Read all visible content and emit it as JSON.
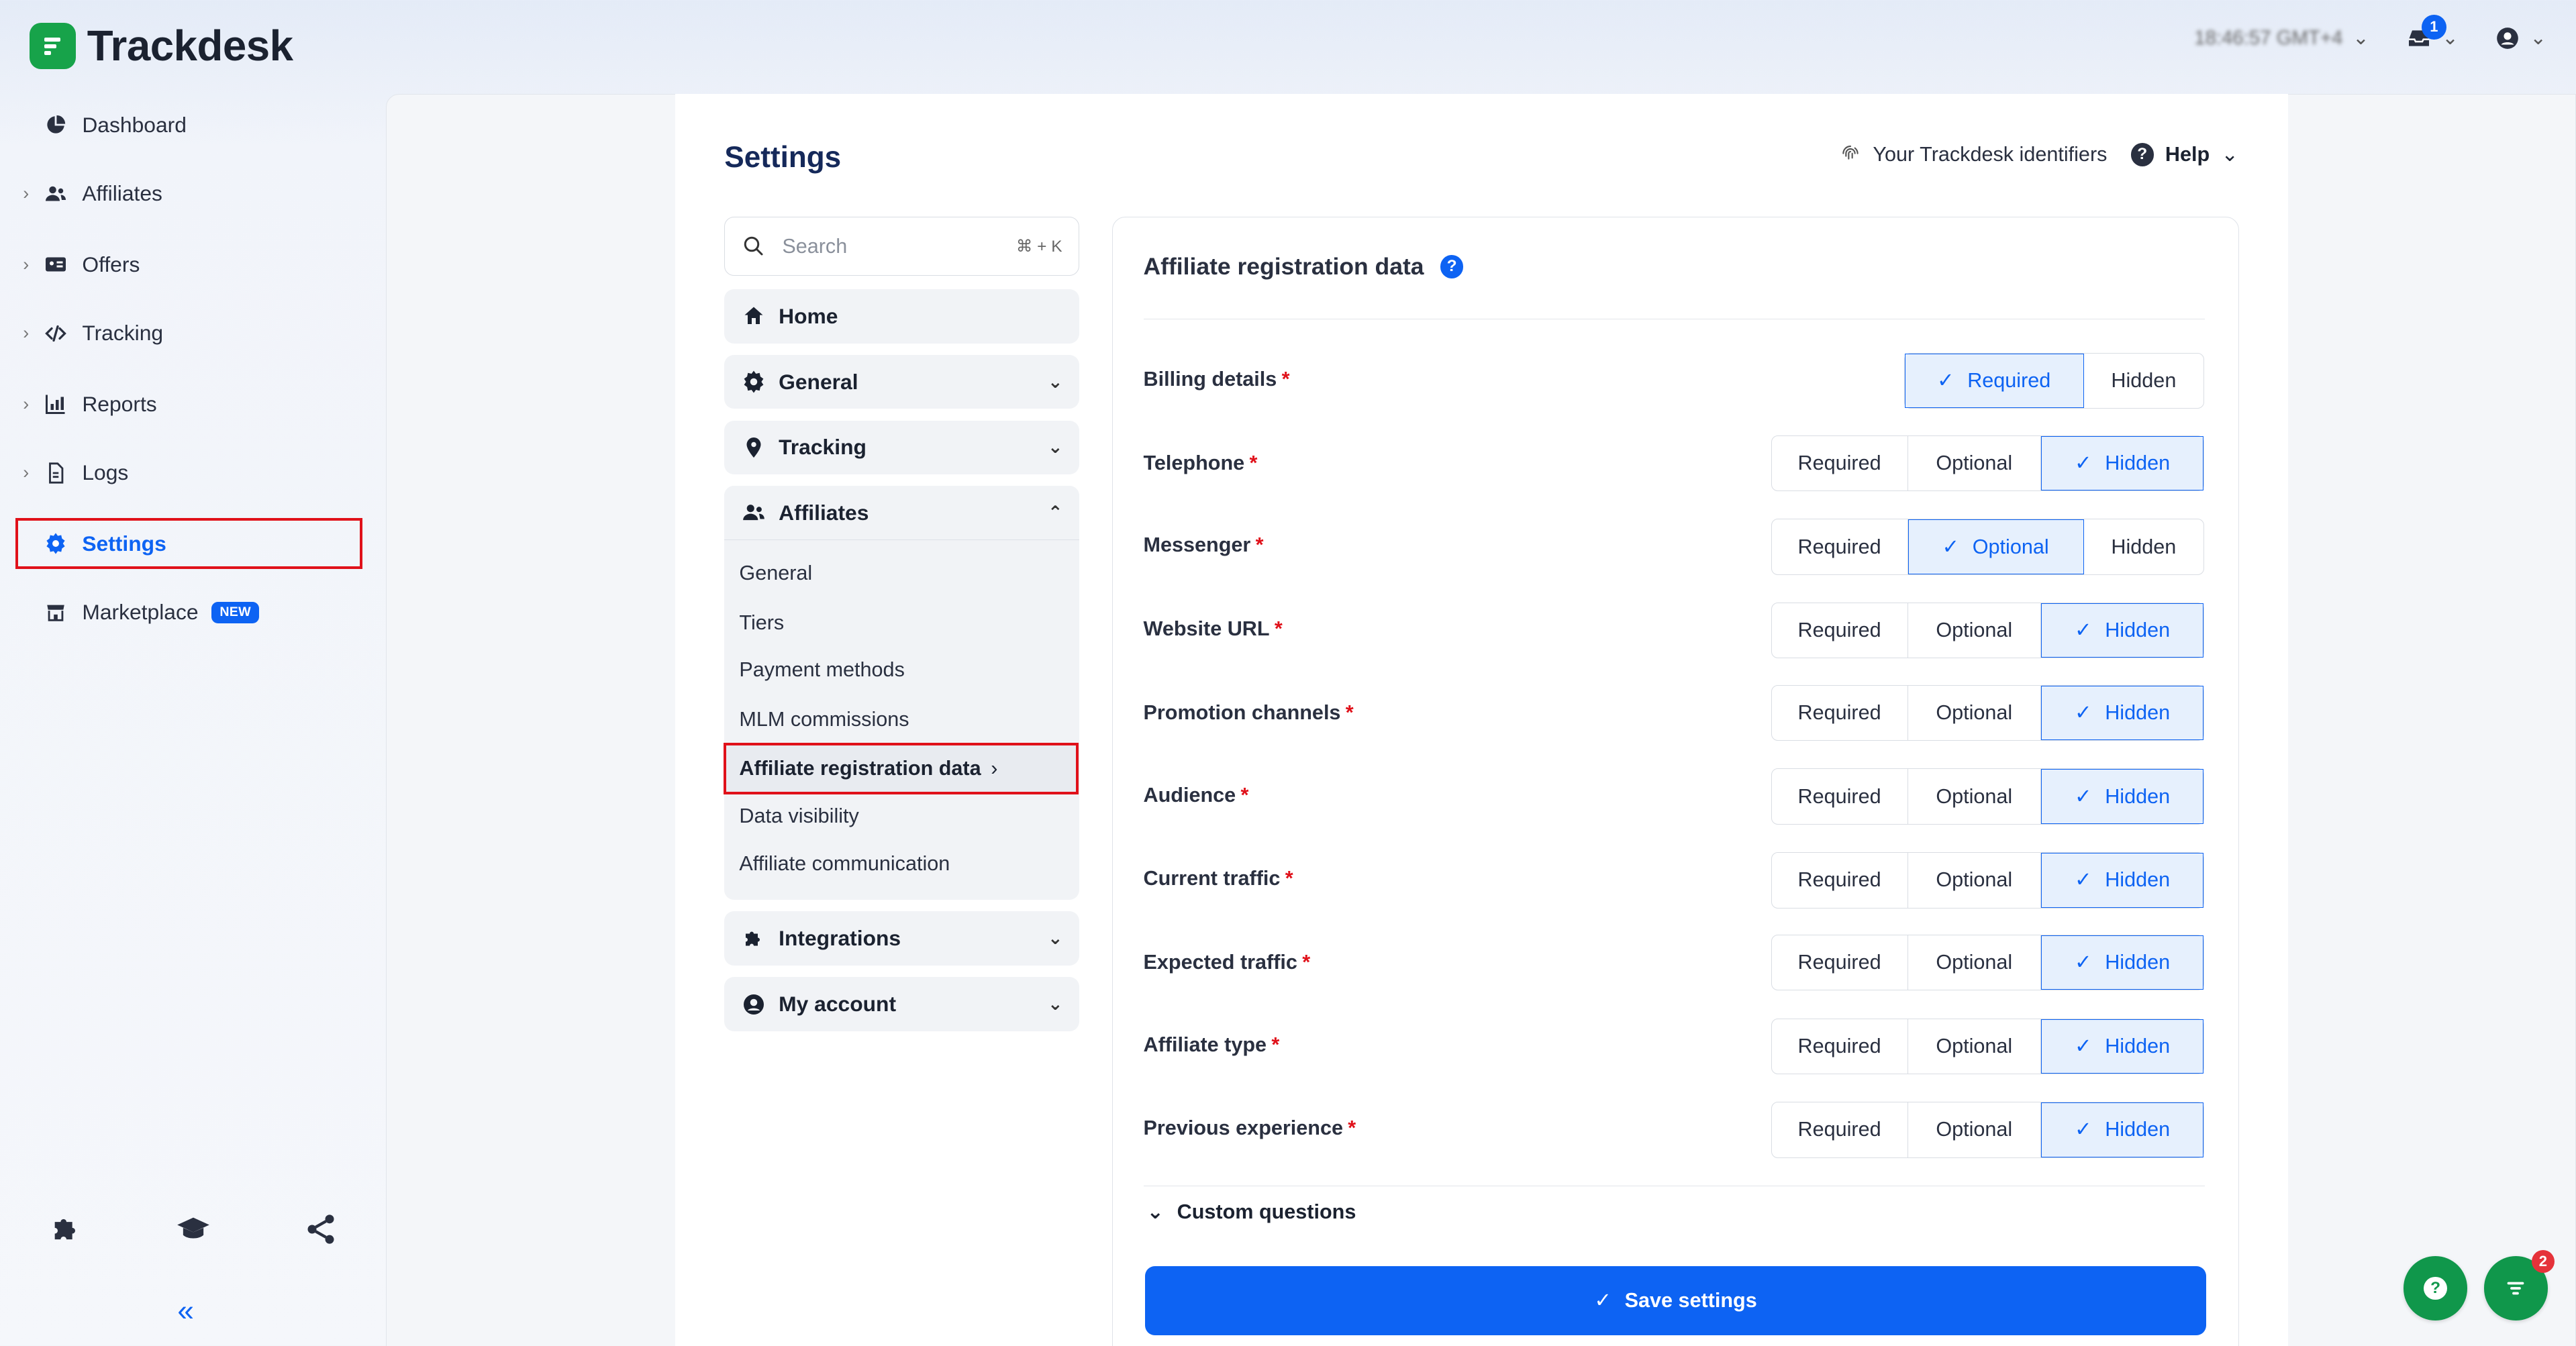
{
  "app": {
    "name": "Trackdesk"
  },
  "topbar": {
    "time": "18:46:57 GMT+4",
    "notifications_count": "1"
  },
  "sidebar": {
    "items": [
      {
        "label": "Dashboard",
        "icon": "pie-chart-icon"
      },
      {
        "label": "Affiliates",
        "icon": "users-icon"
      },
      {
        "label": "Offers",
        "icon": "id-card-icon"
      },
      {
        "label": "Tracking",
        "icon": "code-icon"
      },
      {
        "label": "Reports",
        "icon": "report-chart-icon"
      },
      {
        "label": "Logs",
        "icon": "document-icon"
      },
      {
        "label": "Settings",
        "icon": "gear-icon"
      },
      {
        "label": "Marketplace",
        "icon": "store-icon",
        "badge": "NEW"
      }
    ],
    "bottom_icons": [
      "puzzle-icon",
      "graduation-cap-icon",
      "share-icon"
    ],
    "collapse_label": "«"
  },
  "page": {
    "title": "Settings",
    "identifiers_label": "Your Trackdesk identifiers",
    "help_label": "Help"
  },
  "settings_nav": {
    "search_placeholder": "Search",
    "search_shortcut": "⌘ + K",
    "sections": {
      "home": "Home",
      "general": "General",
      "tracking": "Tracking",
      "affiliates": "Affiliates",
      "integrations": "Integrations",
      "my_account": "My account"
    },
    "affiliates_sub": [
      "General",
      "Tiers",
      "Payment methods",
      "MLM commissions",
      "Affiliate registration data",
      "Data visibility",
      "Affiliate communication"
    ]
  },
  "registration": {
    "title": "Affiliate registration data",
    "options": {
      "required": "Required",
      "optional": "Optional",
      "hidden": "Hidden"
    },
    "rows": [
      {
        "label": "Billing details",
        "selected": "Required"
      },
      {
        "label": "Telephone",
        "selected": "Hidden"
      },
      {
        "label": "Messenger",
        "selected": "Optional"
      },
      {
        "label": "Website URL",
        "selected": "Hidden"
      },
      {
        "label": "Promotion channels",
        "selected": "Hidden"
      },
      {
        "label": "Audience",
        "selected": "Hidden"
      },
      {
        "label": "Current traffic",
        "selected": "Hidden"
      },
      {
        "label": "Expected traffic",
        "selected": "Hidden"
      },
      {
        "label": "Affiliate type",
        "selected": "Hidden"
      },
      {
        "label": "Previous experience",
        "selected": "Hidden"
      }
    ],
    "required_marker": "*",
    "custom_questions": "Custom questions",
    "save_label": "Save settings"
  },
  "fab": {
    "chat_badge": "2"
  },
  "colors": {
    "accent": "#0d63f3",
    "brand": "#17a34a",
    "highlight": "#e0111a"
  }
}
